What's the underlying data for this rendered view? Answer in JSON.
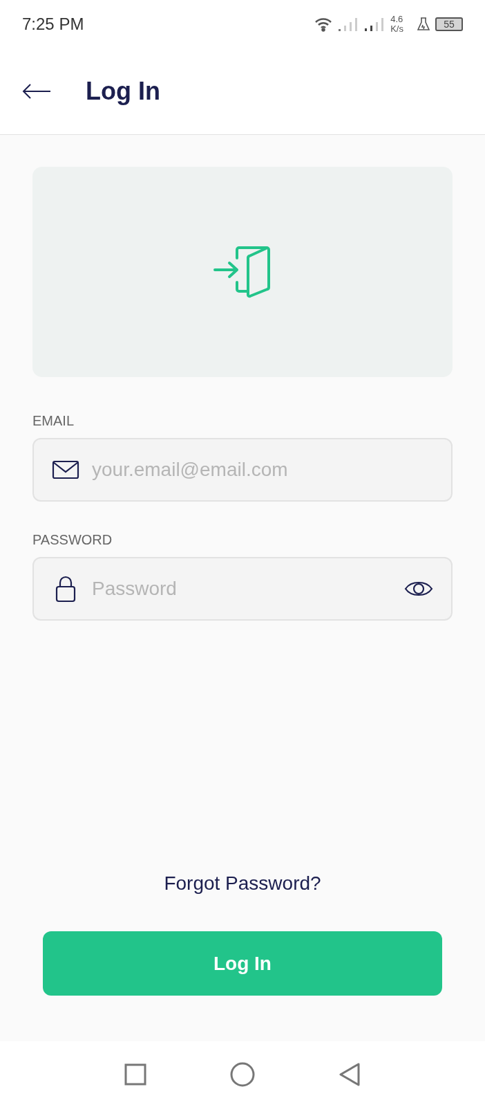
{
  "status_bar": {
    "time": "7:25 PM",
    "speed_value": "4.6",
    "speed_unit": "K/s",
    "battery": "55"
  },
  "header": {
    "title": "Log In"
  },
  "form": {
    "fields": [
      {
        "kind": "email",
        "label": "EMAIL",
        "placeholder": "your.email@email.com"
      },
      {
        "kind": "password",
        "label": "PASSWORD",
        "placeholder": "Password"
      }
    ],
    "forgot_link": "Forgot Password?",
    "submit": "Log In"
  }
}
